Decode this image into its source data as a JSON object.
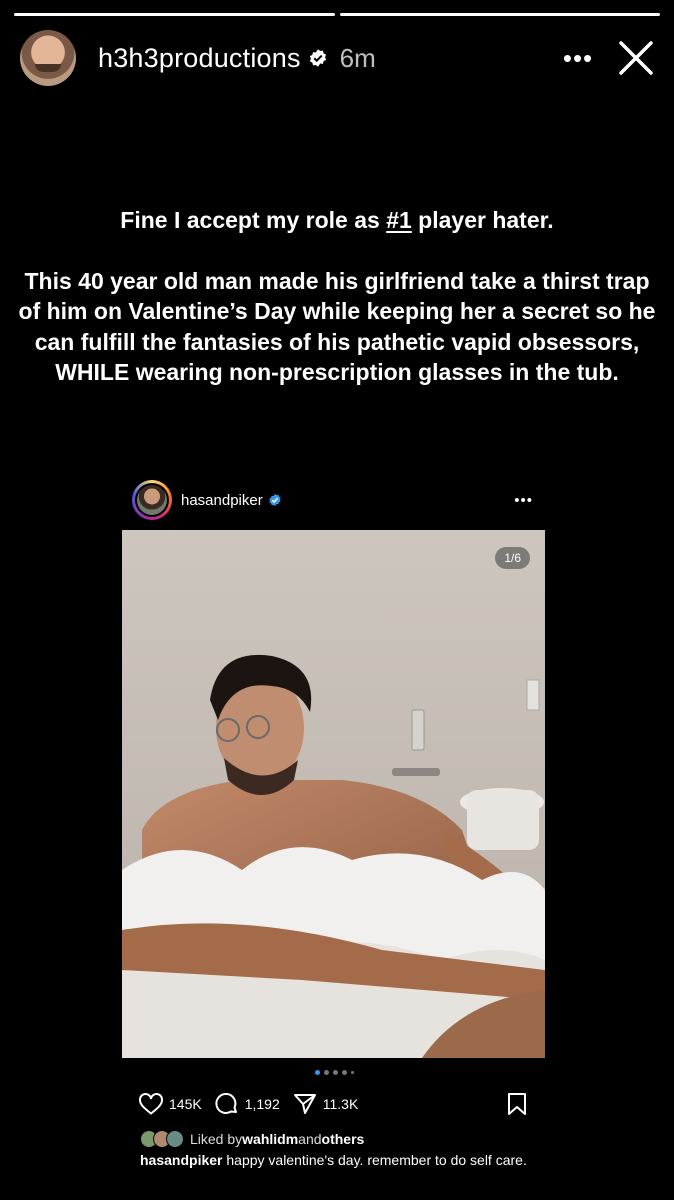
{
  "story": {
    "progress": [
      1.0,
      1.0
    ],
    "username": "h3h3productions",
    "time": "6m",
    "more_label": "•••"
  },
  "caption": {
    "line1_before": "Fine I accept my role as ",
    "line1_tag": "#1",
    "line1_after": " player hater.",
    "line2": "This 40 year old man made his girlfriend take a thirst trap of him on Valentine’s Day while keeping her a secret so he can fulfill the fantasies of his pathetic vapid obsessors, WHILE wearing non-prescription glasses in the tub."
  },
  "post": {
    "username": "hasandpiker",
    "more_label": "•••",
    "counter": "1/6",
    "likes": "145K",
    "comments": "1,192",
    "shares": "11.3K",
    "liked_prefix": "Liked by ",
    "liked_user": "wahlidm",
    "liked_mid": " and ",
    "liked_others": "others",
    "caption_user": "hasandpiker",
    "caption_text": " happy valentine's day. remember to do self care."
  },
  "colors": {
    "background": "#000000",
    "verified": "#3897f0",
    "dot_active": "#3897f0"
  }
}
